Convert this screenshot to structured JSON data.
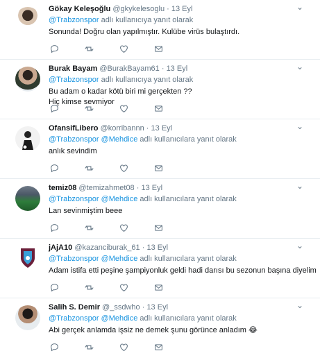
{
  "reply_prefix": "adlı kullanıcıya yanıt olarak",
  "reply_prefix_plural": "adlı kullanıcılara yanıt olarak",
  "tweets": [
    {
      "name": "Gökay Keleşoğlu",
      "handle": "@gkykelesoglu",
      "time": "13 Eyl",
      "mentions": [
        "@Trabzonspor"
      ],
      "text": [
        "Sonunda! Doğru olan yapılmıştır. Kulübe virüs bulaştırdı."
      ]
    },
    {
      "name": "Burak Bayam",
      "handle": "@BurakBayam61",
      "time": "13 Eyl",
      "mentions": [
        "@Trabzonspor"
      ],
      "text": [
        "Bu adam o kadar kötü biri mi gerçekten ??",
        "Hiç kimse sevmiyor"
      ]
    },
    {
      "name": "OfansifLibero",
      "handle": "@korribannn",
      "time": "13 Eyl",
      "mentions": [
        "@Trabzonspor",
        "@Mehdice"
      ],
      "text": [
        "anlık sevindim"
      ]
    },
    {
      "name": "temiz08",
      "handle": "@temizahmet08",
      "time": "13 Eyl",
      "mentions": [
        "@Trabzonspor",
        "@Mehdice"
      ],
      "text": [
        "Lan sevinmiştim beee"
      ]
    },
    {
      "name": "jAjA10",
      "handle": "@kazanciburak_61",
      "time": "13 Eyl",
      "mentions": [
        "@Trabzonspor",
        "@Mehdice"
      ],
      "text": [
        "Adam istifa etti peşine şampiyonluk geldi hadi darısı bu sezonun başına diyelim"
      ]
    },
    {
      "name": "Salih S. Demir",
      "handle": "@_ssdwho",
      "time": "13 Eyl",
      "mentions": [
        "@Trabzonspor",
        "@Mehdice"
      ],
      "text": [
        "Abi gerçek anlamda işsiz ne demek şunu görünce anladım 😂"
      ]
    }
  ],
  "icons": [
    "reply-icon",
    "retweet-icon",
    "like-icon",
    "message-icon"
  ],
  "colors": {
    "link": "#1b95e0",
    "muted": "#657786",
    "text": "#14171a",
    "divider": "#e6ecf0"
  }
}
